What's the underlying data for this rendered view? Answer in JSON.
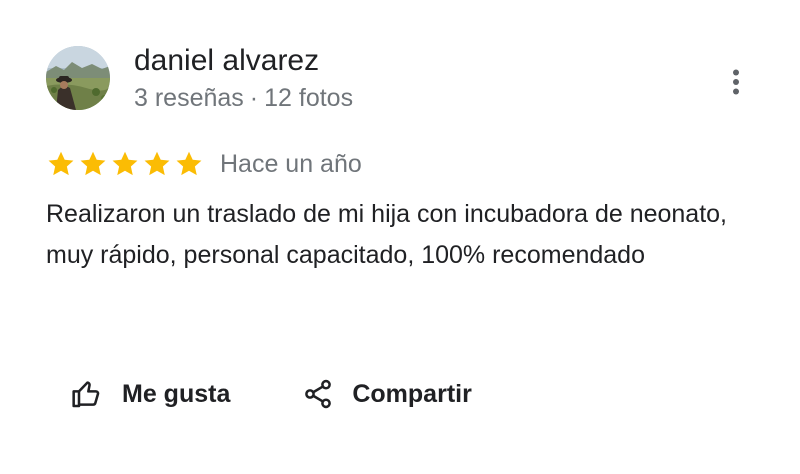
{
  "author": {
    "name": "daniel alvarez",
    "reviews": "3 reseñas",
    "separator": "·",
    "photos": "12 fotos"
  },
  "rating": {
    "stars": 5,
    "max": 5,
    "color": "#fbbc04"
  },
  "time_ago": "Hace un año",
  "review_text": "Realizaron un traslado de mi hija con incubadora de neonato, muy rápido, personal capacitado, 100% recomendado",
  "actions": {
    "like_label": "Me gusta",
    "like_icon": "thumbs-up-icon",
    "share_label": "Compartir",
    "share_icon": "share-icon"
  },
  "menu_icon": "more-vertical-icon"
}
